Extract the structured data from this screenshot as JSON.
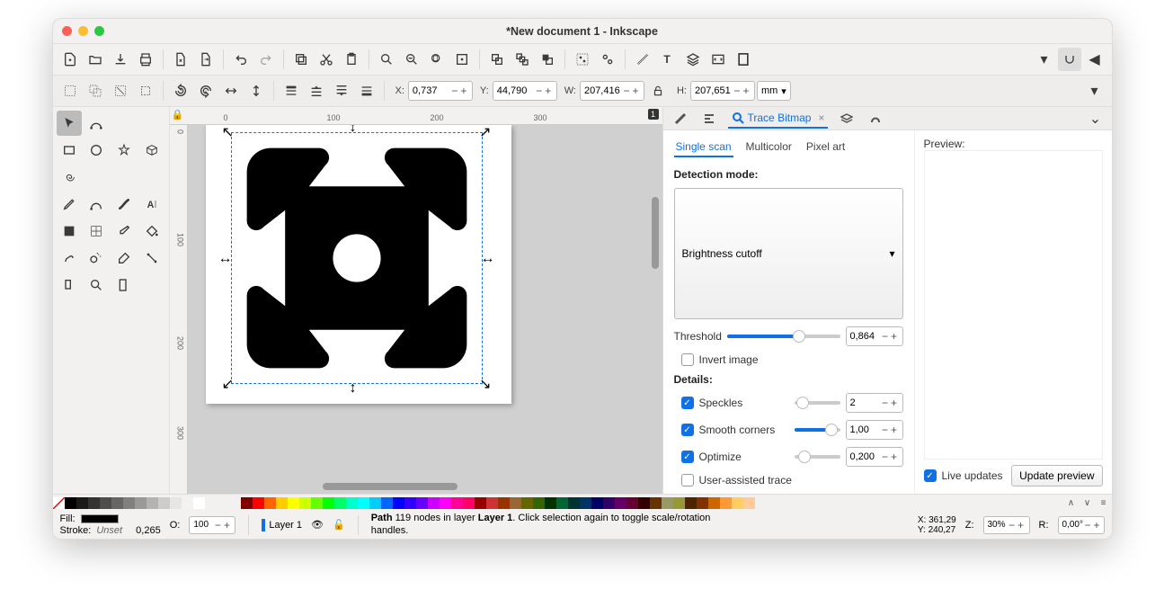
{
  "window": {
    "title": "*New document 1 - Inkscape"
  },
  "coords": {
    "x_label": "X:",
    "x": "0,737",
    "y_label": "Y:",
    "y": "44,790",
    "w_label": "W:",
    "w": "207,416",
    "h_label": "H:",
    "h": "207,651",
    "unit": "mm"
  },
  "ruler_h": [
    "0",
    "100",
    "200",
    "300"
  ],
  "ruler_v": [
    "0",
    "100",
    "200",
    "300"
  ],
  "page_corner": "1",
  "dock": {
    "tab1": "",
    "tab2": "",
    "tab3": "Trace Bitmap",
    "tab4": "",
    "tab5": ""
  },
  "trace": {
    "subtabs": {
      "single": "Single scan",
      "multi": "Multicolor",
      "pixel": "Pixel art"
    },
    "detection_label": "Detection mode:",
    "mode": "Brightness cutoff",
    "threshold_label": "Threshold",
    "threshold_val": "0,864",
    "invert_label": "Invert image",
    "details_label": "Details:",
    "speckles_label": "Speckles",
    "speckles_val": "2",
    "smooth_label": "Smooth corners",
    "smooth_val": "1,00",
    "optimize_label": "Optimize",
    "optimize_val": "0,200",
    "userassist_label": "User-assisted trace",
    "preview_label": "Preview:",
    "live_label": "Live updates",
    "update_btn": "Update preview"
  },
  "status": {
    "fill_label": "Fill:",
    "stroke_label": "Stroke:",
    "stroke_val": "Unset",
    "stroke_w": "0,265",
    "opacity_label": "O:",
    "opacity_val": "100",
    "layer_label": "Layer 1",
    "msg_prefix": "Path",
    "msg_nodes": "119 nodes in layer",
    "msg_layer": "Layer 1",
    "msg_suffix": ". Click selection again to toggle scale/rotation handles.",
    "cursor_x_label": "X:",
    "cursor_x": "361,29",
    "cursor_y_label": "Y:",
    "cursor_y": "240,27",
    "zoom_label": "Z:",
    "zoom": "30%",
    "rot_label": "R:",
    "rot": "0,00°"
  },
  "palette_grays": [
    "#000000",
    "#1a1a1a",
    "#333333",
    "#4d4d4d",
    "#666666",
    "#808080",
    "#999999",
    "#b3b3b3",
    "#cccccc",
    "#e6e6e6",
    "#f2f2f2",
    "#ffffff"
  ],
  "palette_colors": [
    "#800000",
    "#ff0000",
    "#ff6600",
    "#ffcc00",
    "#ffff00",
    "#ccff00",
    "#66ff00",
    "#00ff00",
    "#00ff66",
    "#00ffcc",
    "#00ffff",
    "#00ccff",
    "#0066ff",
    "#0000ff",
    "#3300ff",
    "#6600ff",
    "#cc00ff",
    "#ff00ff",
    "#ff0099",
    "#ff0066",
    "#990000",
    "#cc3333",
    "#993300",
    "#996633",
    "#666600",
    "#336600",
    "#003300",
    "#006633",
    "#003333",
    "#003366",
    "#000066",
    "#330066",
    "#660066",
    "#660033",
    "#330000",
    "#663300",
    "#999966",
    "#999933",
    "#4d2600",
    "#803300",
    "#cc6600",
    "#ff9933",
    "#ffcc66",
    "#ffcc99"
  ]
}
